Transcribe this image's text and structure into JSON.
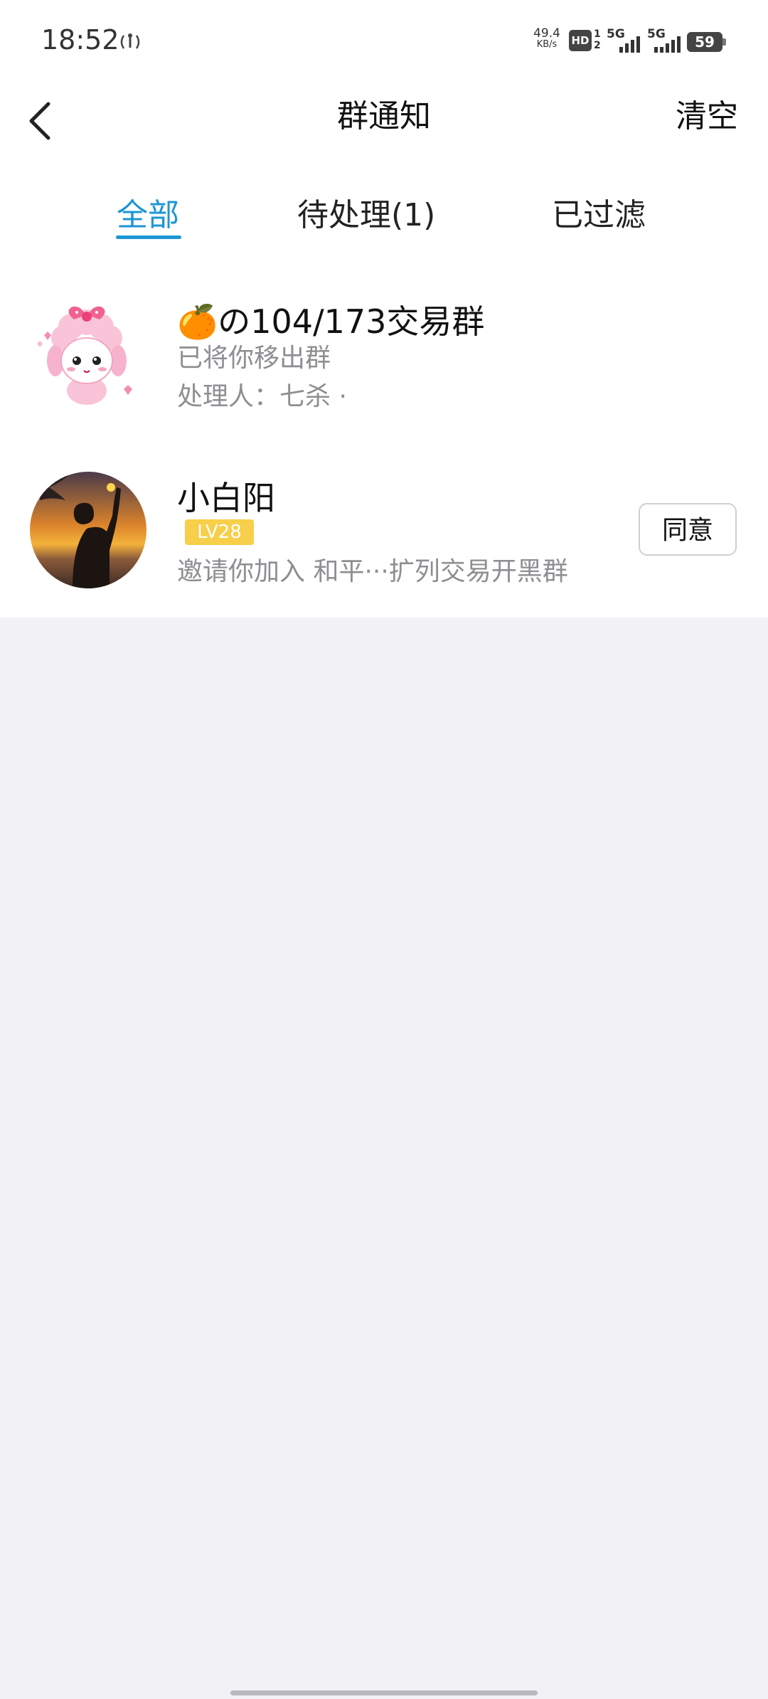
{
  "status_bar": {
    "time": "18:52",
    "net_speed_value": "49.4",
    "net_speed_unit": "KB/s",
    "hd": "HD",
    "sim_top": "1",
    "sim_bottom": "2",
    "signal1": "5G",
    "signal2": "5G",
    "battery": "59"
  },
  "header": {
    "title": "群通知",
    "clear_label": "清空"
  },
  "tabs": [
    {
      "label": "全部",
      "active": true
    },
    {
      "label": "待处理(1)",
      "active": false
    },
    {
      "label": "已过滤",
      "active": false
    }
  ],
  "notifications": [
    {
      "name": "🍊の104/173交易群",
      "line1": "已将你移出群",
      "line2": "处理人：七杀 ·"
    },
    {
      "name": "小白阳",
      "level": "LV28",
      "line1": "邀请你加入 和平···扩列交易开黑群",
      "action_label": "同意"
    }
  ],
  "colors": {
    "accent": "#1c96d4",
    "level_badge": "#f7cf4a",
    "secondary_text": "#8e8e93",
    "background": "#f1f1f6"
  }
}
